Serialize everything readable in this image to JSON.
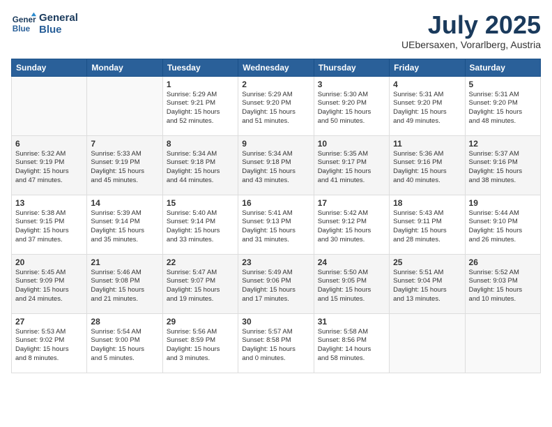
{
  "header": {
    "logo_line1": "General",
    "logo_line2": "Blue",
    "month": "July 2025",
    "location": "UEbersaxen, Vorarlberg, Austria"
  },
  "weekdays": [
    "Sunday",
    "Monday",
    "Tuesday",
    "Wednesday",
    "Thursday",
    "Friday",
    "Saturday"
  ],
  "weeks": [
    [
      {
        "day": "",
        "info": ""
      },
      {
        "day": "",
        "info": ""
      },
      {
        "day": "1",
        "info": "Sunrise: 5:29 AM\nSunset: 9:21 PM\nDaylight: 15 hours\nand 52 minutes."
      },
      {
        "day": "2",
        "info": "Sunrise: 5:29 AM\nSunset: 9:20 PM\nDaylight: 15 hours\nand 51 minutes."
      },
      {
        "day": "3",
        "info": "Sunrise: 5:30 AM\nSunset: 9:20 PM\nDaylight: 15 hours\nand 50 minutes."
      },
      {
        "day": "4",
        "info": "Sunrise: 5:31 AM\nSunset: 9:20 PM\nDaylight: 15 hours\nand 49 minutes."
      },
      {
        "day": "5",
        "info": "Sunrise: 5:31 AM\nSunset: 9:20 PM\nDaylight: 15 hours\nand 48 minutes."
      }
    ],
    [
      {
        "day": "6",
        "info": "Sunrise: 5:32 AM\nSunset: 9:19 PM\nDaylight: 15 hours\nand 47 minutes."
      },
      {
        "day": "7",
        "info": "Sunrise: 5:33 AM\nSunset: 9:19 PM\nDaylight: 15 hours\nand 45 minutes."
      },
      {
        "day": "8",
        "info": "Sunrise: 5:34 AM\nSunset: 9:18 PM\nDaylight: 15 hours\nand 44 minutes."
      },
      {
        "day": "9",
        "info": "Sunrise: 5:34 AM\nSunset: 9:18 PM\nDaylight: 15 hours\nand 43 minutes."
      },
      {
        "day": "10",
        "info": "Sunrise: 5:35 AM\nSunset: 9:17 PM\nDaylight: 15 hours\nand 41 minutes."
      },
      {
        "day": "11",
        "info": "Sunrise: 5:36 AM\nSunset: 9:16 PM\nDaylight: 15 hours\nand 40 minutes."
      },
      {
        "day": "12",
        "info": "Sunrise: 5:37 AM\nSunset: 9:16 PM\nDaylight: 15 hours\nand 38 minutes."
      }
    ],
    [
      {
        "day": "13",
        "info": "Sunrise: 5:38 AM\nSunset: 9:15 PM\nDaylight: 15 hours\nand 37 minutes."
      },
      {
        "day": "14",
        "info": "Sunrise: 5:39 AM\nSunset: 9:14 PM\nDaylight: 15 hours\nand 35 minutes."
      },
      {
        "day": "15",
        "info": "Sunrise: 5:40 AM\nSunset: 9:14 PM\nDaylight: 15 hours\nand 33 minutes."
      },
      {
        "day": "16",
        "info": "Sunrise: 5:41 AM\nSunset: 9:13 PM\nDaylight: 15 hours\nand 31 minutes."
      },
      {
        "day": "17",
        "info": "Sunrise: 5:42 AM\nSunset: 9:12 PM\nDaylight: 15 hours\nand 30 minutes."
      },
      {
        "day": "18",
        "info": "Sunrise: 5:43 AM\nSunset: 9:11 PM\nDaylight: 15 hours\nand 28 minutes."
      },
      {
        "day": "19",
        "info": "Sunrise: 5:44 AM\nSunset: 9:10 PM\nDaylight: 15 hours\nand 26 minutes."
      }
    ],
    [
      {
        "day": "20",
        "info": "Sunrise: 5:45 AM\nSunset: 9:09 PM\nDaylight: 15 hours\nand 24 minutes."
      },
      {
        "day": "21",
        "info": "Sunrise: 5:46 AM\nSunset: 9:08 PM\nDaylight: 15 hours\nand 21 minutes."
      },
      {
        "day": "22",
        "info": "Sunrise: 5:47 AM\nSunset: 9:07 PM\nDaylight: 15 hours\nand 19 minutes."
      },
      {
        "day": "23",
        "info": "Sunrise: 5:49 AM\nSunset: 9:06 PM\nDaylight: 15 hours\nand 17 minutes."
      },
      {
        "day": "24",
        "info": "Sunrise: 5:50 AM\nSunset: 9:05 PM\nDaylight: 15 hours\nand 15 minutes."
      },
      {
        "day": "25",
        "info": "Sunrise: 5:51 AM\nSunset: 9:04 PM\nDaylight: 15 hours\nand 13 minutes."
      },
      {
        "day": "26",
        "info": "Sunrise: 5:52 AM\nSunset: 9:03 PM\nDaylight: 15 hours\nand 10 minutes."
      }
    ],
    [
      {
        "day": "27",
        "info": "Sunrise: 5:53 AM\nSunset: 9:02 PM\nDaylight: 15 hours\nand 8 minutes."
      },
      {
        "day": "28",
        "info": "Sunrise: 5:54 AM\nSunset: 9:00 PM\nDaylight: 15 hours\nand 5 minutes."
      },
      {
        "day": "29",
        "info": "Sunrise: 5:56 AM\nSunset: 8:59 PM\nDaylight: 15 hours\nand 3 minutes."
      },
      {
        "day": "30",
        "info": "Sunrise: 5:57 AM\nSunset: 8:58 PM\nDaylight: 15 hours\nand 0 minutes."
      },
      {
        "day": "31",
        "info": "Sunrise: 5:58 AM\nSunset: 8:56 PM\nDaylight: 14 hours\nand 58 minutes."
      },
      {
        "day": "",
        "info": ""
      },
      {
        "day": "",
        "info": ""
      }
    ]
  ]
}
